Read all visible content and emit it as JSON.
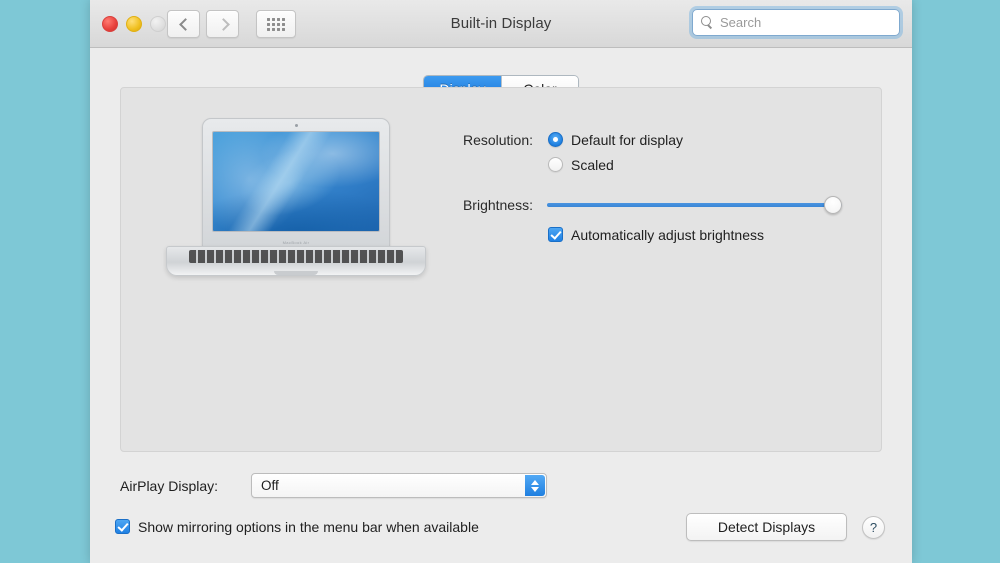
{
  "window": {
    "title": "Built-in Display",
    "traffic_lights": [
      "close",
      "minimize",
      "zoom"
    ],
    "nav": {
      "back": "back",
      "forward": "forward",
      "show_all": "show-all"
    },
    "search": {
      "placeholder": "Search",
      "value": ""
    }
  },
  "tabs": [
    {
      "label": "Display",
      "selected": true
    },
    {
      "label": "Color",
      "selected": false
    }
  ],
  "preview": {
    "device": "MacBook Air",
    "brand_text": "MacBook Air"
  },
  "controls": {
    "resolution": {
      "label": "Resolution:",
      "options": [
        {
          "label": "Default for display",
          "selected": true
        },
        {
          "label": "Scaled",
          "selected": false
        }
      ]
    },
    "brightness": {
      "label": "Brightness:",
      "value_percent": 100
    },
    "auto_brightness": {
      "label": "Automatically adjust brightness",
      "checked": true
    }
  },
  "bottom": {
    "airplay": {
      "label": "AirPlay Display:",
      "value": "Off"
    },
    "mirroring": {
      "label": "Show mirroring options in the menu bar when available",
      "checked": true
    },
    "detect_displays_label": "Detect Displays",
    "help_label": "?"
  },
  "colors": {
    "desktop_background": "#7ec8d6",
    "accent_blue": "#1f80e3",
    "tab_active": "#2d88e5",
    "panel_background": "#e3e3e3",
    "window_background": "#ececec"
  }
}
